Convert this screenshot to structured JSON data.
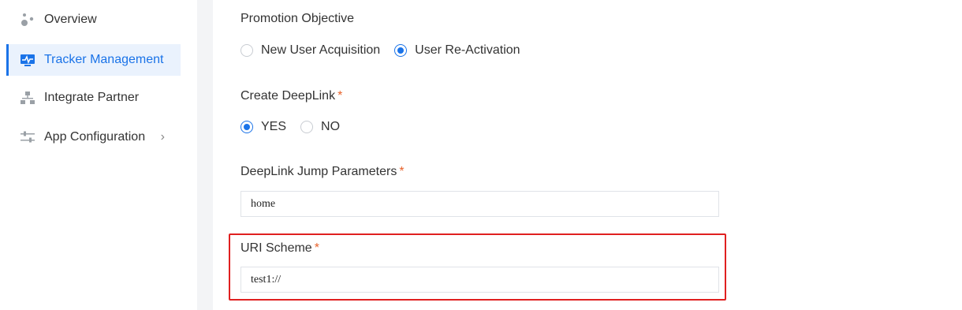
{
  "sidebar": {
    "items": [
      {
        "label": "Overview",
        "icon": "overview-icon"
      },
      {
        "label": "Tracker Management",
        "icon": "tracker-icon"
      },
      {
        "label": "Integrate Partner",
        "icon": "partner-icon"
      },
      {
        "label": "App Configuration",
        "icon": "sliders-icon"
      }
    ],
    "app_config_chevron": "›"
  },
  "form": {
    "promotion_objective": {
      "label": "Promotion Objective",
      "options": [
        "New User Acquisition",
        "User Re-Activation"
      ],
      "selected": "User Re-Activation"
    },
    "create_deeplink": {
      "label": "Create DeepLink",
      "required_mark": "*",
      "options": [
        "YES",
        "NO"
      ],
      "selected": "YES"
    },
    "deeplink_params": {
      "label": "DeepLink Jump Parameters",
      "required_mark": "*",
      "value": "home"
    },
    "uri_scheme": {
      "label": "URI Scheme",
      "required_mark": "*",
      "value": "test1://"
    }
  },
  "colors": {
    "accent": "#1a73e8",
    "required": "#e8632c",
    "highlight": "#e02020"
  }
}
